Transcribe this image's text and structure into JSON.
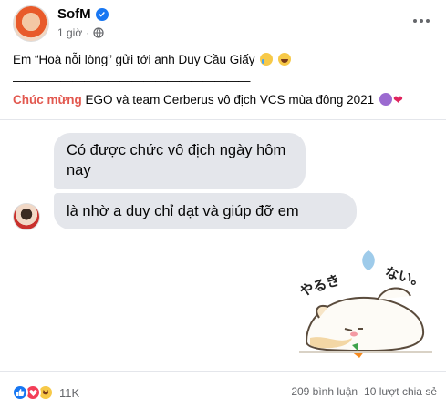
{
  "post": {
    "author": "SofM",
    "time": "1 giờ",
    "separator": "·",
    "line1": "Em “Hoà nỗi lòng” gửi tới anh Duy Cầu Giấy",
    "line2": "————————————————————",
    "line3_highlight": "Chúc mừng",
    "line3_rest": " EGO và team Cerberus vô địch VCS mùa đông 2021",
    "heart": "❤"
  },
  "chat": {
    "message1": "Có được chức vô địch ngày hôm nay",
    "message2": "là nhờ a duy chỉ dạt và giúp đỡ em",
    "sticker_text_left": "やるき",
    "sticker_text_right": "ない。"
  },
  "footer": {
    "reaction_count": "11K",
    "comments": "209 bình luận",
    "shares": "10 lượt chia sẻ"
  },
  "colors": {
    "highlight": "#e2584f",
    "bubble": "#e4e6eb",
    "verified": "#1877f2",
    "muted": "#65676b"
  },
  "icons": [
    "verified-badge-icon",
    "globe-icon",
    "more-options-icon",
    "like-reaction-icon",
    "love-reaction-icon",
    "haha-reaction-icon"
  ]
}
